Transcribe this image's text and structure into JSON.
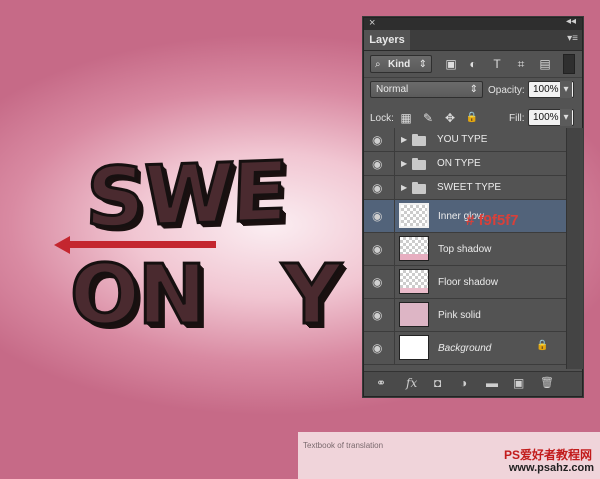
{
  "canvas": {
    "words": [
      "SWEET",
      "ON",
      "YOU"
    ],
    "visible_text": {
      "sweet": "SWE",
      "on": "ON",
      "you": "Y"
    },
    "arrow_color": "#c4262f",
    "hex_annotation": "# f9f5f7"
  },
  "panel": {
    "close_glyph": "×",
    "collapse_glyph": "◂◂",
    "tab_label": "Layers",
    "menu_glyph": "▾≡",
    "filter": {
      "icon": "⌕",
      "label": "Kind",
      "arrow": "⇕"
    },
    "filter_icons": [
      "▣",
      "◐",
      "T",
      "⌗",
      "▤"
    ],
    "blend_mode": "Normal",
    "blend_arrow": "⇕",
    "opacity_label": "Opacity:",
    "opacity_value": "100%",
    "dropdown_arrow": "▾",
    "lock_label": "Lock:",
    "lock_icons": [
      "▦",
      "✎",
      "✥",
      "🔒"
    ],
    "fill_label": "Fill:",
    "fill_value": "100%",
    "layers": [
      {
        "name": "YOU TYPE",
        "type": "group"
      },
      {
        "name": "ON TYPE",
        "type": "group"
      },
      {
        "name": "SWEET TYPE",
        "type": "group"
      },
      {
        "name": "Inner glow",
        "type": "layer",
        "thumb": "checker",
        "selected": true
      },
      {
        "name": "Top shadow",
        "type": "layer",
        "thumb": "checker-pink"
      },
      {
        "name": "Floor shadow",
        "type": "layer",
        "thumb": "checker-pink"
      },
      {
        "name": "Pink solid",
        "type": "layer",
        "thumb": "pink"
      },
      {
        "name": "Background",
        "type": "layer",
        "thumb": "white",
        "locked": true
      }
    ],
    "eye_glyph": "◉",
    "group_arrow": "▶",
    "lock_glyph": "🔒",
    "bottom_icons": [
      "⚭",
      "fx",
      "◘",
      "◑",
      "▬",
      "▣",
      "🗑"
    ]
  },
  "footer": {
    "caption": "Textbook of translation",
    "watermark_1": "PS爱好者教程网",
    "watermark_2": "www.psahz.com"
  },
  "colors": {
    "panel_bg": "#535353",
    "selected_row": "#52637a",
    "pink_thumb": "#ddb5c5"
  }
}
